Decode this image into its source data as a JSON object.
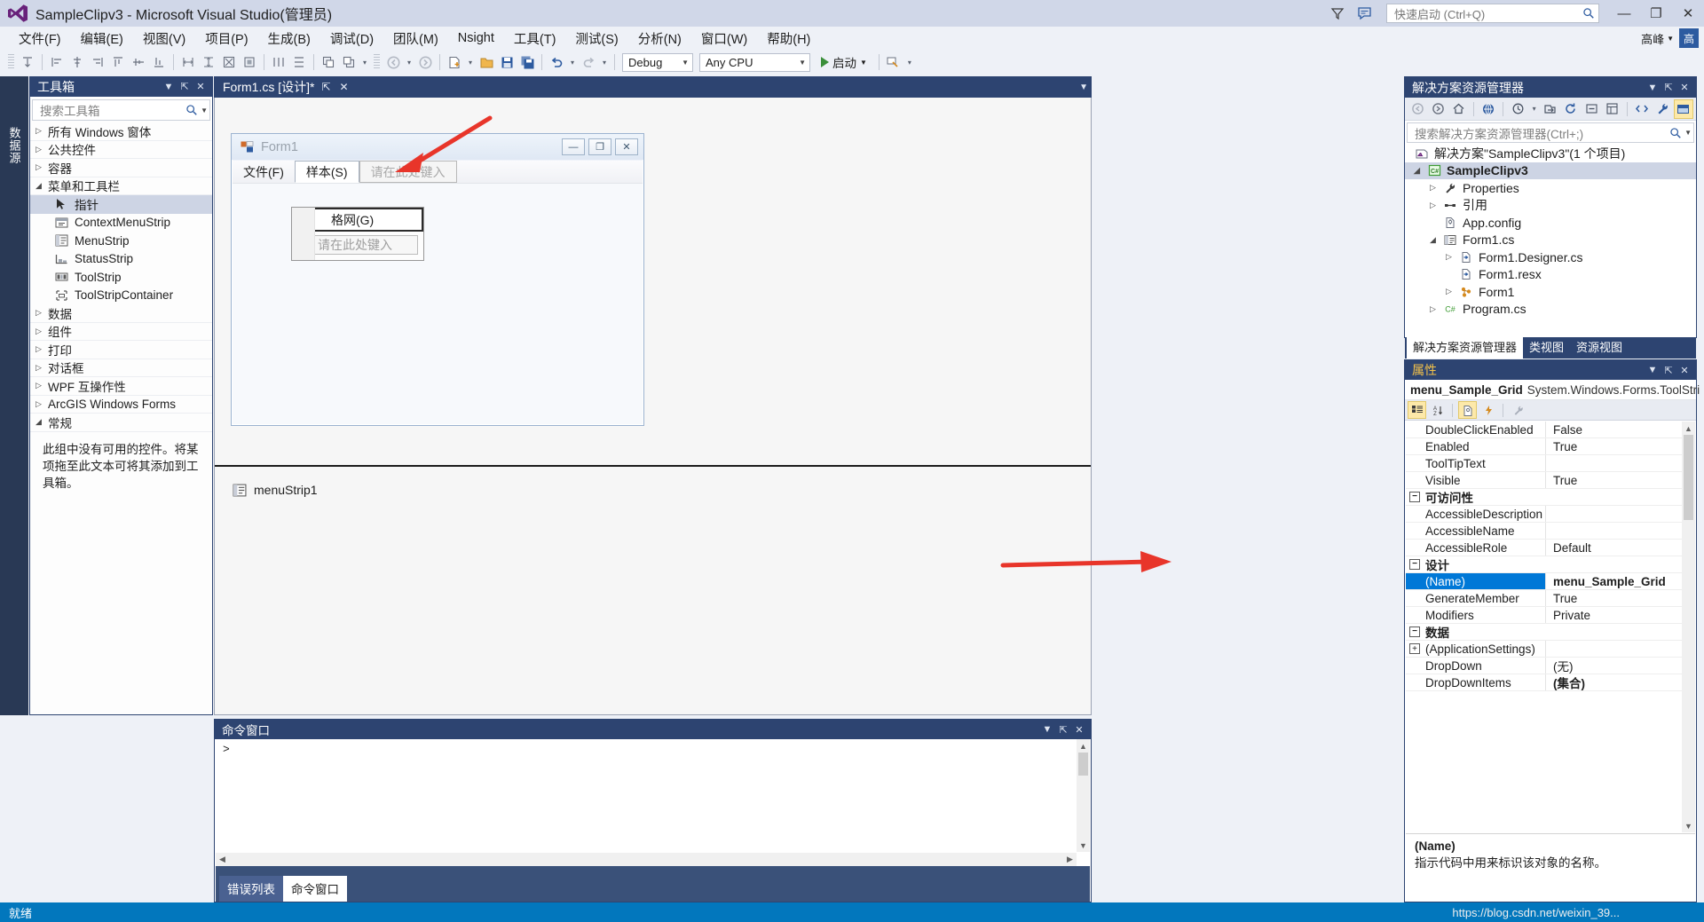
{
  "titlebar": {
    "title": "SampleClipv3 - Microsoft Visual Studio(管理员)",
    "quick_launch_placeholder": "快速启动 (Ctrl+Q)",
    "icons": {
      "filter": "filter-icon",
      "feedback": "feedback-icon",
      "search": "search-icon"
    },
    "window_buttons": {
      "minimize": "—",
      "restore": "❐",
      "close": "✕"
    }
  },
  "menubar": {
    "items": [
      {
        "label": "文件(F)"
      },
      {
        "label": "编辑(E)"
      },
      {
        "label": "视图(V)"
      },
      {
        "label": "项目(P)"
      },
      {
        "label": "生成(B)"
      },
      {
        "label": "调试(D)"
      },
      {
        "label": "团队(M)"
      },
      {
        "label": "Nsight"
      },
      {
        "label": "工具(T)"
      },
      {
        "label": "测试(S)"
      },
      {
        "label": "分析(N)"
      },
      {
        "label": "窗口(W)"
      },
      {
        "label": "帮助(H)"
      }
    ],
    "user": "高峰",
    "avatar_initial": "高"
  },
  "toolbar": {
    "config": "Debug",
    "platform": "Any CPU",
    "start_label": "启动"
  },
  "vertical_tab": {
    "label": "数据源"
  },
  "toolbox": {
    "title": "工具箱",
    "search_placeholder": "搜索工具箱",
    "groups": [
      {
        "label": "所有 Windows 窗体",
        "expanded": false
      },
      {
        "label": "公共控件",
        "expanded": false
      },
      {
        "label": "容器",
        "expanded": false
      },
      {
        "label": "菜单和工具栏",
        "expanded": true
      }
    ],
    "items": [
      {
        "label": "指针",
        "icon": "pointer-icon",
        "selected": true
      },
      {
        "label": "ContextMenuStrip",
        "icon": "contextmenustrip-icon",
        "selected": false
      },
      {
        "label": "MenuStrip",
        "icon": "menustrip-icon",
        "selected": false
      },
      {
        "label": "StatusStrip",
        "icon": "statusstrip-icon",
        "selected": false
      },
      {
        "label": "ToolStrip",
        "icon": "toolstrip-icon",
        "selected": false
      },
      {
        "label": "ToolStripContainer",
        "icon": "toolstripcontainer-icon",
        "selected": false
      }
    ],
    "groups_after": [
      {
        "label": "数据"
      },
      {
        "label": "组件"
      },
      {
        "label": "打印"
      },
      {
        "label": "对话框"
      },
      {
        "label": "WPF 互操作性"
      },
      {
        "label": "ArcGIS Windows Forms"
      }
    ],
    "general_group": {
      "label": "常规",
      "expanded": true
    },
    "empty_note": "此组中没有可用的控件。将某项拖至此文本可将其添加到工具箱。"
  },
  "document": {
    "tab_label": "Form1.cs [设计]*",
    "pin_glyph": "⇱",
    "close_glyph": "✕"
  },
  "winform": {
    "title": "Form1",
    "menu_items": [
      {
        "label": "文件(F)",
        "state": "normal"
      },
      {
        "label": "样本(S)",
        "state": "selected"
      },
      {
        "label": "请在此处键入",
        "state": "placeholder"
      }
    ],
    "dropdown": [
      {
        "label": "格网(G)",
        "state": "active"
      },
      {
        "label": "请在此处键入",
        "state": "placeholder"
      }
    ],
    "caption_buttons": {
      "minimize": "—",
      "maximize": "❐",
      "close": "✕"
    }
  },
  "component_tray": {
    "items": [
      {
        "label": "menuStrip1",
        "icon": "menustrip-icon"
      }
    ]
  },
  "command_window": {
    "title": "命令窗口",
    "prompt": ">",
    "tabs": [
      {
        "label": "错误列表",
        "active": false
      },
      {
        "label": "命令窗口",
        "active": true
      }
    ]
  },
  "solution_explorer": {
    "title": "解决方案资源管理器",
    "search_placeholder": "搜索解决方案资源管理器(Ctrl+;)",
    "tree": [
      {
        "label": "解决方案\"SampleClipv3\"(1 个项目)",
        "indent": 0,
        "expander": "none",
        "icon": "solution-icon",
        "bold": false,
        "selected": false
      },
      {
        "label": "SampleClipv3",
        "indent": 1,
        "expander": "expanded",
        "icon": "csharp-project-icon",
        "bold": true,
        "selected": true
      },
      {
        "label": "Properties",
        "indent": 2,
        "expander": "collapsed",
        "icon": "wrench-icon",
        "bold": false,
        "selected": false
      },
      {
        "label": "引用",
        "indent": 2,
        "expander": "collapsed",
        "icon": "references-icon",
        "bold": false,
        "selected": false
      },
      {
        "label": "App.config",
        "indent": 2,
        "expander": "none",
        "icon": "config-icon",
        "bold": false,
        "selected": false
      },
      {
        "label": "Form1.cs",
        "indent": 2,
        "expander": "expanded",
        "icon": "form-icon",
        "bold": false,
        "selected": false
      },
      {
        "label": "Form1.Designer.cs",
        "indent": 3,
        "expander": "collapsed",
        "icon": "csfile-icon",
        "bold": false,
        "selected": false
      },
      {
        "label": "Form1.resx",
        "indent": 3,
        "expander": "none",
        "icon": "csfile-icon",
        "bold": false,
        "selected": false
      },
      {
        "label": "Form1",
        "indent": 3,
        "expander": "collapsed",
        "icon": "class-icon",
        "bold": false,
        "selected": false
      },
      {
        "label": "Program.cs",
        "indent": 2,
        "expander": "collapsed",
        "icon": "csharp-icon",
        "bold": false,
        "selected": false
      }
    ],
    "tabs": [
      {
        "label": "解决方案资源管理器",
        "active": true
      },
      {
        "label": "类视图",
        "active": false
      },
      {
        "label": "资源视图",
        "active": false
      }
    ]
  },
  "properties": {
    "title": "属性",
    "object_name": "menu_Sample_Grid",
    "object_type": "System.Windows.Forms.ToolStri",
    "rows": [
      {
        "kind": "prop",
        "key": "DoubleClickEnabled",
        "value": "False",
        "selected": false,
        "bold": false
      },
      {
        "kind": "prop",
        "key": "Enabled",
        "value": "True",
        "selected": false,
        "bold": false
      },
      {
        "kind": "prop",
        "key": "ToolTipText",
        "value": "",
        "selected": false,
        "bold": false
      },
      {
        "kind": "prop",
        "key": "Visible",
        "value": "True",
        "selected": false,
        "bold": false
      },
      {
        "kind": "cat",
        "key": "可访问性",
        "value": "",
        "expander": "−"
      },
      {
        "kind": "prop",
        "key": "AccessibleDescription",
        "value": "",
        "selected": false,
        "bold": false
      },
      {
        "kind": "prop",
        "key": "AccessibleName",
        "value": "",
        "selected": false,
        "bold": false
      },
      {
        "kind": "prop",
        "key": "AccessibleRole",
        "value": "Default",
        "selected": false,
        "bold": false
      },
      {
        "kind": "cat",
        "key": "设计",
        "value": "",
        "expander": "−"
      },
      {
        "kind": "prop",
        "key": "(Name)",
        "value": "menu_Sample_Grid",
        "selected": true,
        "bold": true
      },
      {
        "kind": "prop",
        "key": "GenerateMember",
        "value": "True",
        "selected": false,
        "bold": false
      },
      {
        "kind": "prop",
        "key": "Modifiers",
        "value": "Private",
        "selected": false,
        "bold": false
      },
      {
        "kind": "cat",
        "key": "数据",
        "value": "",
        "expander": "−"
      },
      {
        "kind": "prop",
        "key": "(ApplicationSettings)",
        "value": "",
        "selected": false,
        "bold": false,
        "expander": "+"
      },
      {
        "kind": "prop",
        "key": "DropDown",
        "value": "(无)",
        "selected": false,
        "bold": false
      },
      {
        "kind": "prop",
        "key": "DropDownItems",
        "value": "(集合)",
        "selected": false,
        "bold": true
      }
    ],
    "description_title": "(Name)",
    "description_text": "指示代码中用来标识该对象的名称。"
  },
  "statusbar": {
    "text": "就绪"
  },
  "watermark": {
    "url": "https://blog.csdn.net/weixin_39..."
  },
  "colors": {
    "accent_blue": "#0277bd",
    "panel_header": "#2d4471",
    "titlebar": "#d0d7e8",
    "selection": "#0078d7",
    "arrow_red": "#e8352a",
    "properties_title": "#f2c14a"
  }
}
